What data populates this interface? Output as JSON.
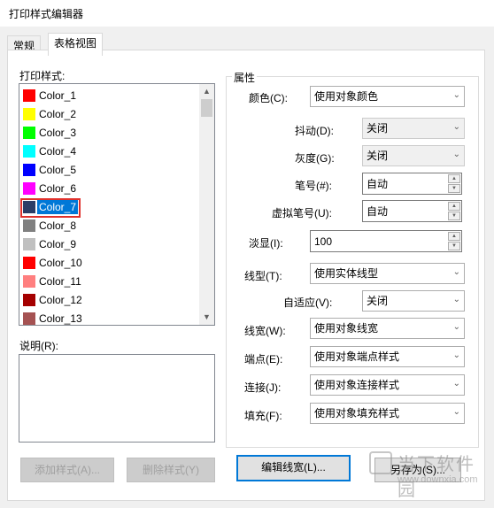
{
  "window": {
    "title": "打印样式编辑器"
  },
  "tabs": [
    {
      "label": "常规"
    },
    {
      "label": "表格视图"
    }
  ],
  "styles_label": "打印样式:",
  "styles": [
    {
      "label": "Color_1",
      "color": "#ff0000"
    },
    {
      "label": "Color_2",
      "color": "#ffff00"
    },
    {
      "label": "Color_3",
      "color": "#00ff00"
    },
    {
      "label": "Color_4",
      "color": "#00ffff"
    },
    {
      "label": "Color_5",
      "color": "#0000ff"
    },
    {
      "label": "Color_6",
      "color": "#ff00ff"
    },
    {
      "label": "Color_7",
      "color": "#2c3e66",
      "selected": true
    },
    {
      "label": "Color_8",
      "color": "#808080"
    },
    {
      "label": "Color_9",
      "color": "#c0c0c0"
    },
    {
      "label": "Color_10",
      "color": "#ff0000"
    },
    {
      "label": "Color_11",
      "color": "#ff7f7f"
    },
    {
      "label": "Color_12",
      "color": "#a50000"
    },
    {
      "label": "Color_13",
      "color": "#a55252"
    }
  ],
  "description_label": "说明(R):",
  "properties": {
    "group_label": "属性",
    "color": {
      "label": "颜色(C):",
      "value": "使用对象颜色"
    },
    "dither": {
      "label": "抖动(D):",
      "value": "关闭"
    },
    "grayscale": {
      "label": "灰度(G):",
      "value": "关闭"
    },
    "pen_number": {
      "label": "笔号(#):",
      "value": "自动"
    },
    "virtual_pen": {
      "label": "虚拟笔号(U):",
      "value": "自动"
    },
    "screening": {
      "label": "淡显(I):",
      "value": "100"
    },
    "linetype": {
      "label": "线型(T):",
      "value": "使用实体线型"
    },
    "adaptive": {
      "label": "自适应(V):",
      "value": "关闭"
    },
    "lineweight": {
      "label": "线宽(W):",
      "value": "使用对象线宽"
    },
    "line_end": {
      "label": "端点(E):",
      "value": "使用对象端点样式"
    },
    "line_join": {
      "label": "连接(J):",
      "value": "使用对象连接样式"
    },
    "fill": {
      "label": "填充(F):",
      "value": "使用对象填充样式"
    }
  },
  "buttons": {
    "add_style": "添加样式(A)...",
    "delete_style": "删除样式(Y)",
    "edit_lineweights": "编辑线宽(L)...",
    "save_as": "另存为(S)..."
  },
  "watermark": {
    "text_cn": "当下软件园",
    "text_url": "www.downxia.com"
  }
}
